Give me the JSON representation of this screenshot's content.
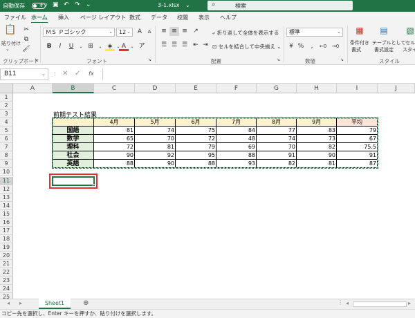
{
  "titlebar": {
    "autosave_label": "自動保存",
    "autosave_state": "オフ",
    "filename": "3-1.xlsx",
    "search_placeholder": "検索"
  },
  "ribbon_tabs": [
    "ファイル",
    "ホーム",
    "挿入",
    "ページ レイアウト",
    "数式",
    "データ",
    "校閲",
    "表示",
    "ヘルプ"
  ],
  "active_tab": "ホーム",
  "ribbon": {
    "clipboard": {
      "paste_label": "貼り付け",
      "group_label": "クリップボード"
    },
    "font": {
      "font_name": "ＭＳ Ｐゴシック",
      "font_size": "12",
      "grow": "A",
      "shrink": "A",
      "bold": "B",
      "italic": "I",
      "underline": "U",
      "color_letter": "A",
      "group_label": "フォント"
    },
    "alignment": {
      "wrap_text": "折り返して全体を表示する",
      "merge_center": "セルを結合して中央揃え",
      "group_label": "配置"
    },
    "number": {
      "format": "標準",
      "group_label": "数値"
    },
    "styles": {
      "conditional": "条件付き",
      "conditional2": "書式",
      "table": "テーブルとして",
      "table2": "書式設定",
      "cell": "セル",
      "cell2": "スタイル",
      "group_label": "スタイル"
    }
  },
  "formula_bar": {
    "name_box": "B11",
    "fx": "fx",
    "formula": ""
  },
  "columns": [
    "A",
    "B",
    "C",
    "D",
    "E",
    "F",
    "G",
    "H",
    "I",
    "J"
  ],
  "selected_column": "B",
  "rows": [
    "1",
    "2",
    "3",
    "4",
    "5",
    "6",
    "7",
    "8",
    "9",
    "10",
    "11",
    "12",
    "13",
    "14",
    "15",
    "16",
    "17",
    "18",
    "19",
    "20",
    "21",
    "22",
    "23",
    "24",
    "25"
  ],
  "selected_row": "11",
  "sheet": {
    "title": "前期テスト結果",
    "headers": [
      "",
      "4月",
      "5月",
      "6月",
      "7月",
      "8月",
      "9月",
      "平均"
    ],
    "rows": [
      {
        "subject": "国語",
        "values": [
          "81",
          "74",
          "75",
          "84",
          "77",
          "83",
          "79"
        ]
      },
      {
        "subject": "数学",
        "values": [
          "65",
          "70",
          "72",
          "48",
          "74",
          "73",
          "67"
        ]
      },
      {
        "subject": "理科",
        "values": [
          "72",
          "81",
          "79",
          "69",
          "70",
          "82",
          "75.5"
        ]
      },
      {
        "subject": "社会",
        "values": [
          "90",
          "92",
          "95",
          "88",
          "91",
          "90",
          "91"
        ]
      },
      {
        "subject": "英語",
        "values": [
          "88",
          "90",
          "88",
          "93",
          "82",
          "81",
          "87"
        ]
      }
    ]
  },
  "sheet_tab": "Sheet1",
  "status_message": "コピー先を選択し、Enter キーを押すか、貼り付けを選択します。",
  "colors": {
    "accent": "#217346",
    "header_fill": "#fff2cc",
    "average_fill": "#fce4d6",
    "subject_fill": "#e2efda",
    "highlight": "#e03131"
  }
}
